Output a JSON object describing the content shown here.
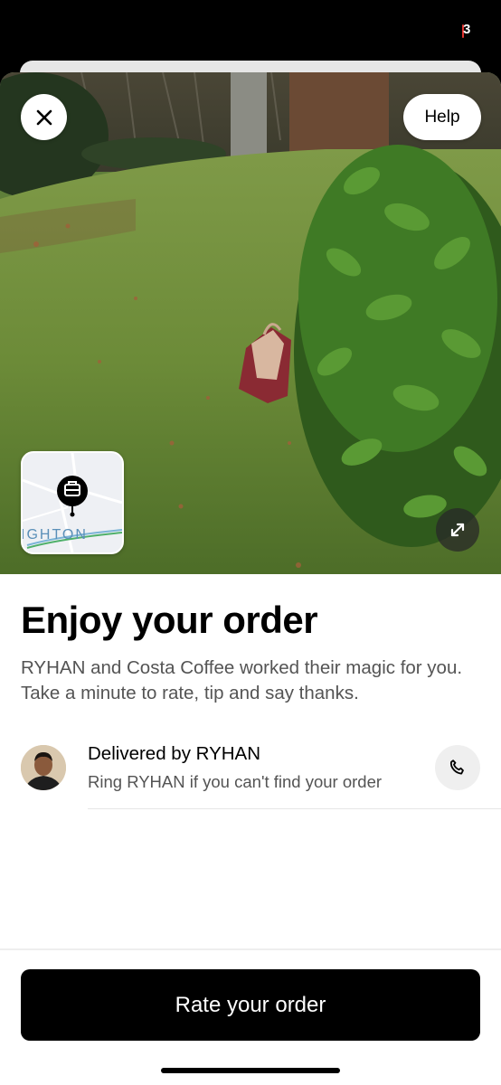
{
  "status_bar": {
    "notification_count": "3"
  },
  "photo": {
    "help_label": "Help",
    "map_label": "IGHTON"
  },
  "content": {
    "title": "Enjoy your order",
    "subtitle": "RYHAN and Costa Coffee worked their magic for you. Take a minute to rate, tip and say thanks."
  },
  "driver": {
    "delivered_by": "Delivered by RYHAN",
    "help_text": "Ring RYHAN if you can't find your order"
  },
  "footer": {
    "rate_label": "Rate your order"
  },
  "colors": {
    "accent_red": "#e0322f",
    "primary": "#000000",
    "map_text": "#5a8fb8"
  },
  "icons": [
    "close-icon",
    "expand-icon",
    "phone-icon",
    "map-pin-icon"
  ]
}
